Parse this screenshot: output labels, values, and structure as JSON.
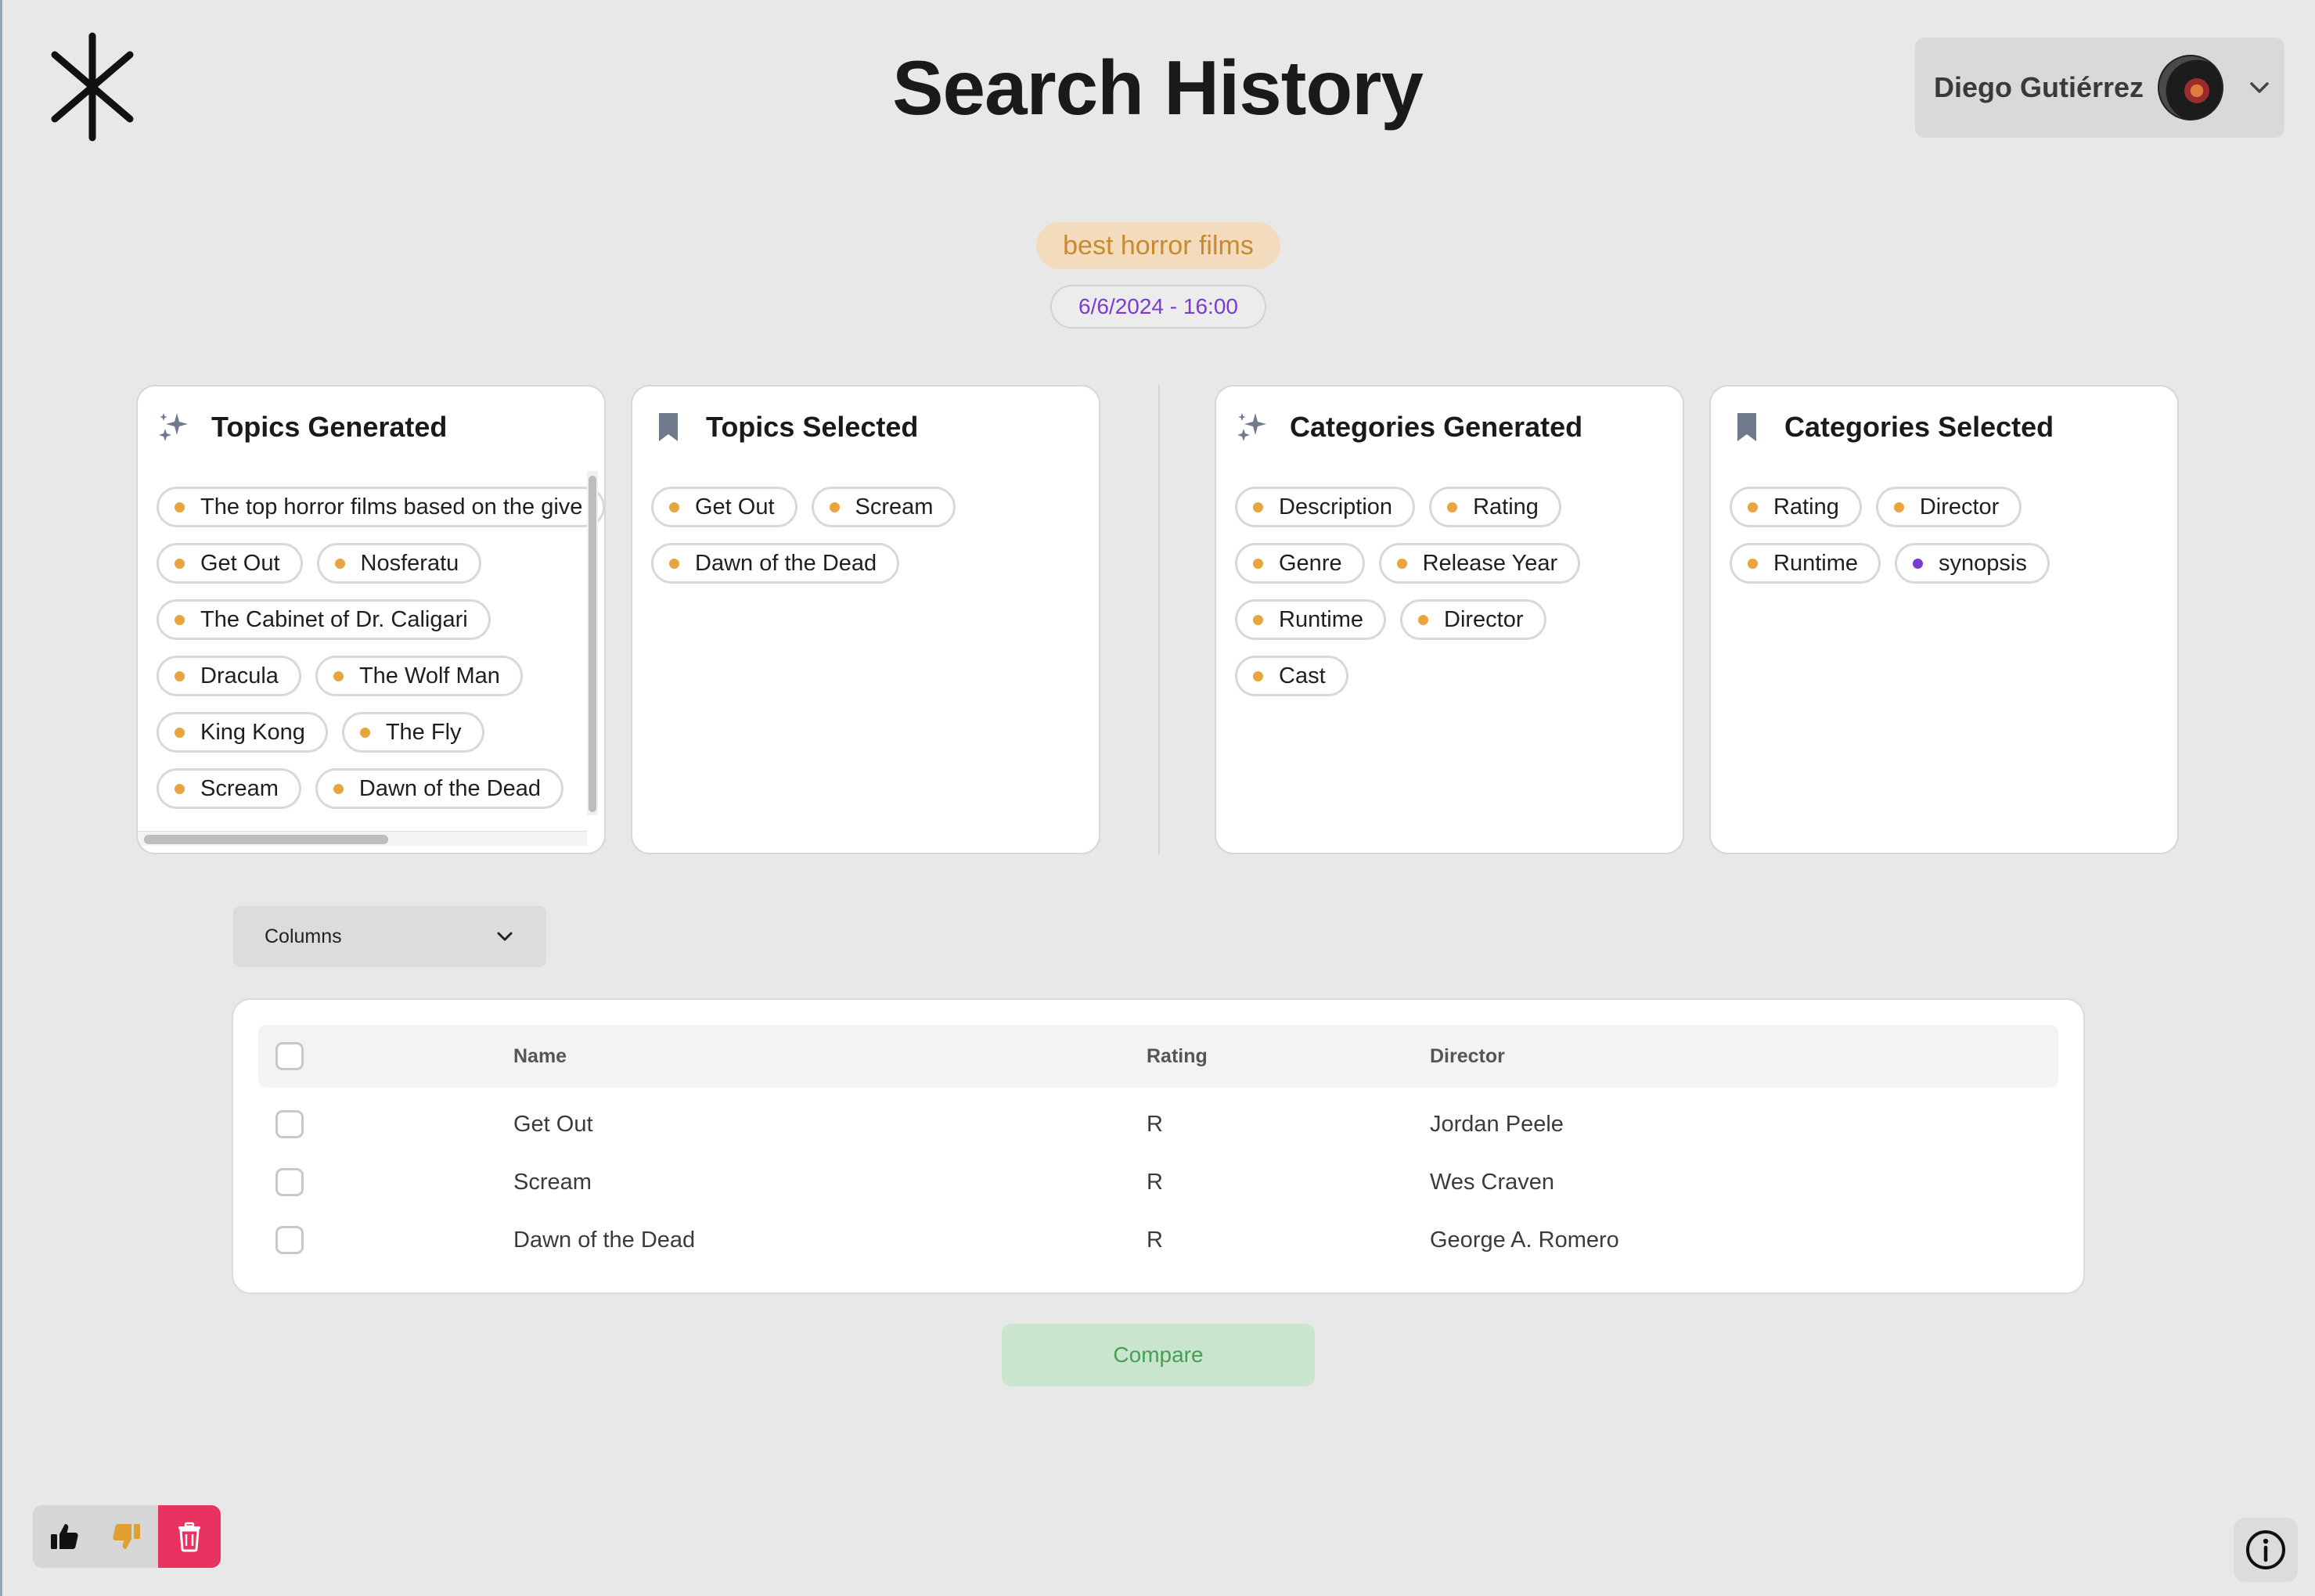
{
  "header": {
    "title": "Search History",
    "user_name": "Diego Gutiérrez"
  },
  "query": {
    "text": "best horror films",
    "datetime": "6/6/2024 - 16:00"
  },
  "cards": {
    "topics_generated": {
      "title": "Topics Generated",
      "icon": "sparkles-icon",
      "items": [
        "The top horror films based on the give",
        "Get Out",
        "Nosferatu",
        "The Cabinet of Dr. Caligari",
        "Dracula",
        "The Wolf Man",
        "King Kong",
        "The Fly",
        "Scream",
        "Dawn of the Dead"
      ]
    },
    "topics_selected": {
      "title": "Topics Selected",
      "icon": "bookmark-icon",
      "items": [
        "Get Out",
        "Scream",
        "Dawn of the Dead"
      ]
    },
    "categories_generated": {
      "title": "Categories Generated",
      "icon": "sparkles-icon",
      "items": [
        "Description",
        "Rating",
        "Genre",
        "Release Year",
        "Runtime",
        "Director",
        "Cast"
      ]
    },
    "categories_selected": {
      "title": "Categories Selected",
      "icon": "bookmark-icon",
      "items": [
        "Rating",
        "Director",
        "Runtime",
        "synopsis"
      ]
    }
  },
  "columns_dropdown": {
    "label": "Columns"
  },
  "table": {
    "headers": [
      "Name",
      "Rating",
      "Director"
    ],
    "rows": [
      [
        "Get Out",
        "R",
        "Jordan Peele"
      ],
      [
        "Scream",
        "R",
        "Wes Craven"
      ],
      [
        "Dawn of the Dead",
        "R",
        "George A. Romero"
      ]
    ]
  },
  "compare_button": {
    "label": "Compare"
  },
  "colors": {
    "accent_orange": "#e8a43e",
    "accent_purple": "#7a3ad0",
    "delete_red": "#e8325f",
    "compare_green": "#45a056"
  },
  "icons": [
    "asterisk-logo-icon",
    "chevron-down-icon",
    "thumbs-up-icon",
    "thumbs-down-icon",
    "trash-icon",
    "info-icon"
  ]
}
